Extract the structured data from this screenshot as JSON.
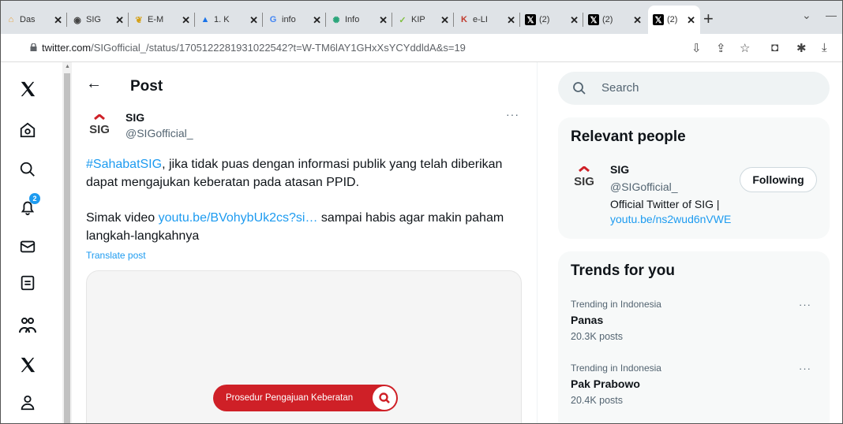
{
  "browser": {
    "tabs": [
      {
        "icon": "sig-tab-icon",
        "title": "Das",
        "color": "#e8a13a"
      },
      {
        "icon": "globe-icon",
        "title": "SIG",
        "color": "#444444"
      },
      {
        "icon": "emblem-icon",
        "title": "E-M",
        "color": "#d4a017"
      },
      {
        "icon": "drive-icon",
        "title": "1. K",
        "color": "#1a73e8"
      },
      {
        "icon": "google-icon",
        "title": "info",
        "color": "#4285f4"
      },
      {
        "icon": "info-site-icon",
        "title": "Info",
        "color": "#2aa57a"
      },
      {
        "icon": "kip-icon",
        "title": "KIP",
        "color": "#7fbf3f"
      },
      {
        "icon": "kk-icon",
        "title": "e-LI",
        "color": "#c0392b"
      },
      {
        "icon": "x-tab-icon",
        "title": "(2)",
        "color": "#000000"
      },
      {
        "icon": "x-tab-icon",
        "title": "(2)",
        "color": "#000000"
      },
      {
        "icon": "x-tab-icon",
        "title": "(2)",
        "color": "#000000"
      }
    ],
    "new_tab": "+",
    "url_host": "twitter.com",
    "url_path": "/SIGofficial_/status/1705122281931022542?t=W-TM6lAY1GHxXsYCYddldA&s=19"
  },
  "post": {
    "header_title": "Post",
    "author_name": "SIG",
    "author_handle": "@SIGofficial_",
    "more": "···",
    "hashtag": "#SahabatSIG",
    "line1": ", jika tidak puas dengan informasi publik yang telah diberikan dapat mengajukan keberatan pada atasan PPID.",
    "line2_pre": "Simak video ",
    "line2_link": "youtu.be/BVohybUk2cs?si…",
    "line2_post": " sampai habis agar makin paham langkah-langkahnya",
    "translate": "Translate post",
    "media_button": "Prosedur Pengajuan Keberatan"
  },
  "sidebar": {
    "search_placeholder": "Search",
    "relevant_title": "Relevant people",
    "rp_name": "SIG",
    "rp_handle": "@SIGofficial_",
    "rp_bio": "Official Twitter of SIG |",
    "rp_link": "youtu.be/ns2wud6nVWE",
    "follow_label": "Following",
    "trends_title": "Trends for you",
    "trends": [
      {
        "meta": "Trending in Indonesia",
        "name": "Panas",
        "count": "20.3K posts"
      },
      {
        "meta": "Trending in Indonesia",
        "name": "Pak Prabowo",
        "count": "20.4K posts"
      }
    ]
  },
  "nav": {
    "badge": "2"
  },
  "colors": {
    "accent": "#1d9bf0",
    "sig_red": "#cf2027",
    "sig_dark": "#3a3a3a"
  }
}
